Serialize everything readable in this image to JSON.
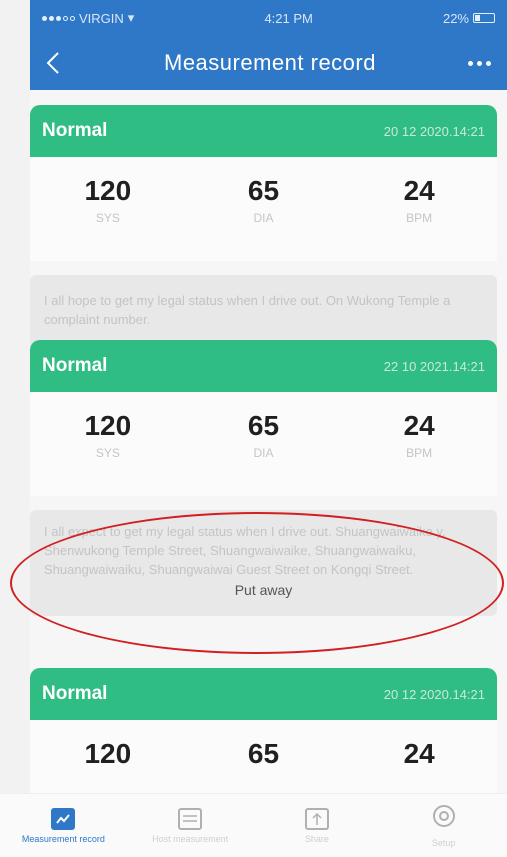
{
  "status_bar": {
    "carrier": "VIRGIN",
    "time": "4:21 PM",
    "battery": "22%"
  },
  "nav": {
    "title": "Measurement  record"
  },
  "cards": [
    {
      "status": "Normal",
      "time": "20 12 2020.14:21",
      "sys": "120",
      "sys_label": "SYS",
      "dia": "65",
      "dia_label": "DIA",
      "bpm": "24",
      "bpm_label": "BPM",
      "note": "I all hope to get my legal status when I drive out. On Wukong Temple a complaint number."
    },
    {
      "status": "Normal",
      "time": "22 10 2021.14:21",
      "sys": "120",
      "sys_label": "SYS",
      "dia": "65",
      "dia_label": "DIA",
      "bpm": "24",
      "bpm_label": "BPM",
      "note": "I all expect to get my legal status when I drive out. Shuangwaiwaike y, Shenwukong Temple Street, Shuangwaiwaike, Shuangwaiwaiku, Shuangwaiwaiku, Shuangwaiwai Guest Street on Kongqi Street.",
      "put_away": "Put away"
    },
    {
      "status": "Normal",
      "time": "20 12 2020.14:21",
      "sys": "120",
      "dia": "65",
      "bpm": "24"
    }
  ],
  "tabs": [
    {
      "label": "Measurement record",
      "icon": "chart-icon",
      "active": true
    },
    {
      "label": "Host measurement",
      "icon": "list-icon",
      "active": false
    },
    {
      "label": "Share",
      "icon": "share-icon",
      "active": false
    },
    {
      "label": "Setup",
      "icon": "settings-icon",
      "active": false
    }
  ],
  "colors": {
    "nav_blue": "#2f78c8",
    "card_green": "#2fbd83",
    "annotation_red": "#d22020"
  }
}
